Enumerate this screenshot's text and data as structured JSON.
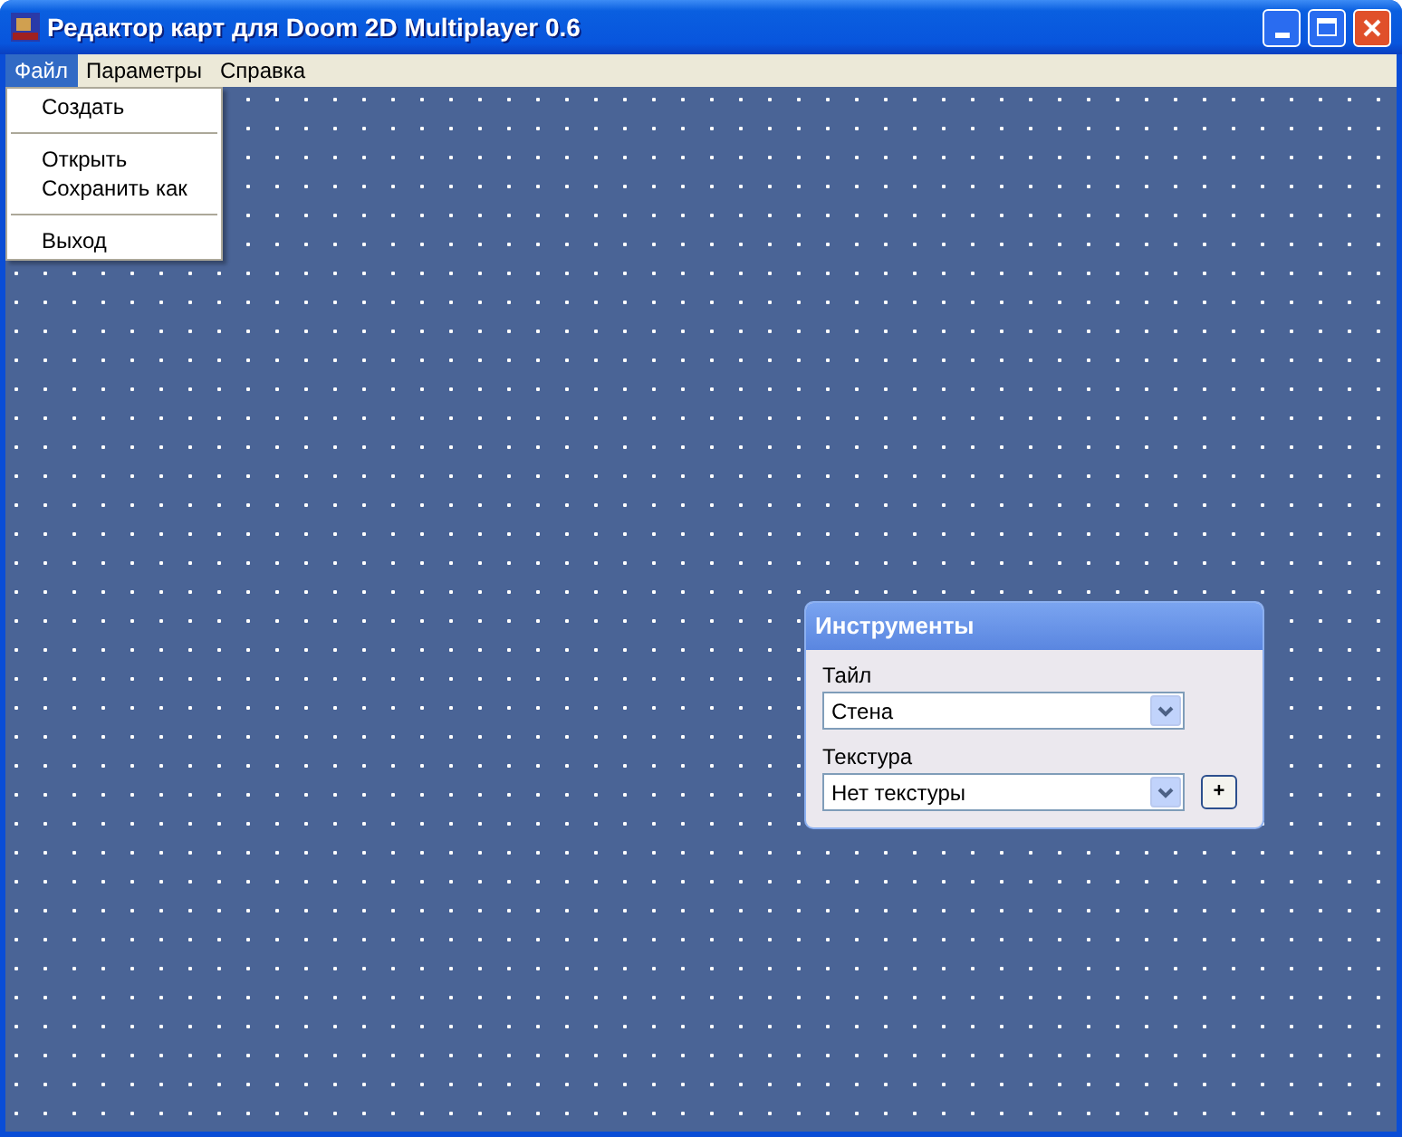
{
  "window": {
    "title": "Редактор карт для Doom 2D Multiplayer 0.6"
  },
  "menu_bar": [
    {
      "label": "Файл",
      "selected": true
    },
    {
      "label": "Параметры",
      "selected": false
    },
    {
      "label": "Справка",
      "selected": false
    }
  ],
  "open_menu": [
    {
      "kind": "item",
      "label": "Создать"
    },
    {
      "kind": "separator"
    },
    {
      "kind": "item",
      "label": "Открыть"
    },
    {
      "kind": "item",
      "label": "Сохранить как"
    },
    {
      "kind": "separator"
    },
    {
      "kind": "item",
      "label": "Выход"
    }
  ],
  "tools_panel": {
    "title": "Инструменты",
    "tile_label": "Тайл",
    "tile_value": "Стена",
    "texture_label": "Текстура",
    "texture_value": "Нет текстуры",
    "add_button": "+"
  }
}
